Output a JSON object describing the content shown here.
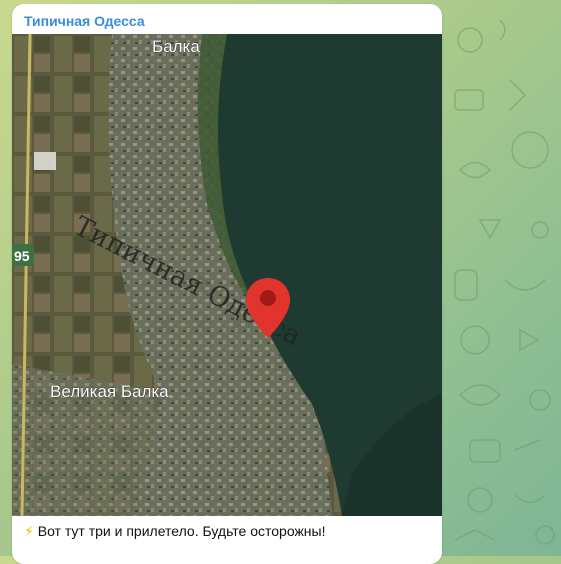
{
  "message": {
    "channel_name": "Типичная Одесса",
    "caption_icon": "⚡",
    "caption_text": "Вот тут три и прилетело. Будьте осторожны!"
  },
  "map": {
    "labels": {
      "top_village": "Балка",
      "bottom_village": "Великая Балка",
      "road_number": "95",
      "watermark": "Типичная Одесса"
    },
    "marker": "location-pin"
  }
}
